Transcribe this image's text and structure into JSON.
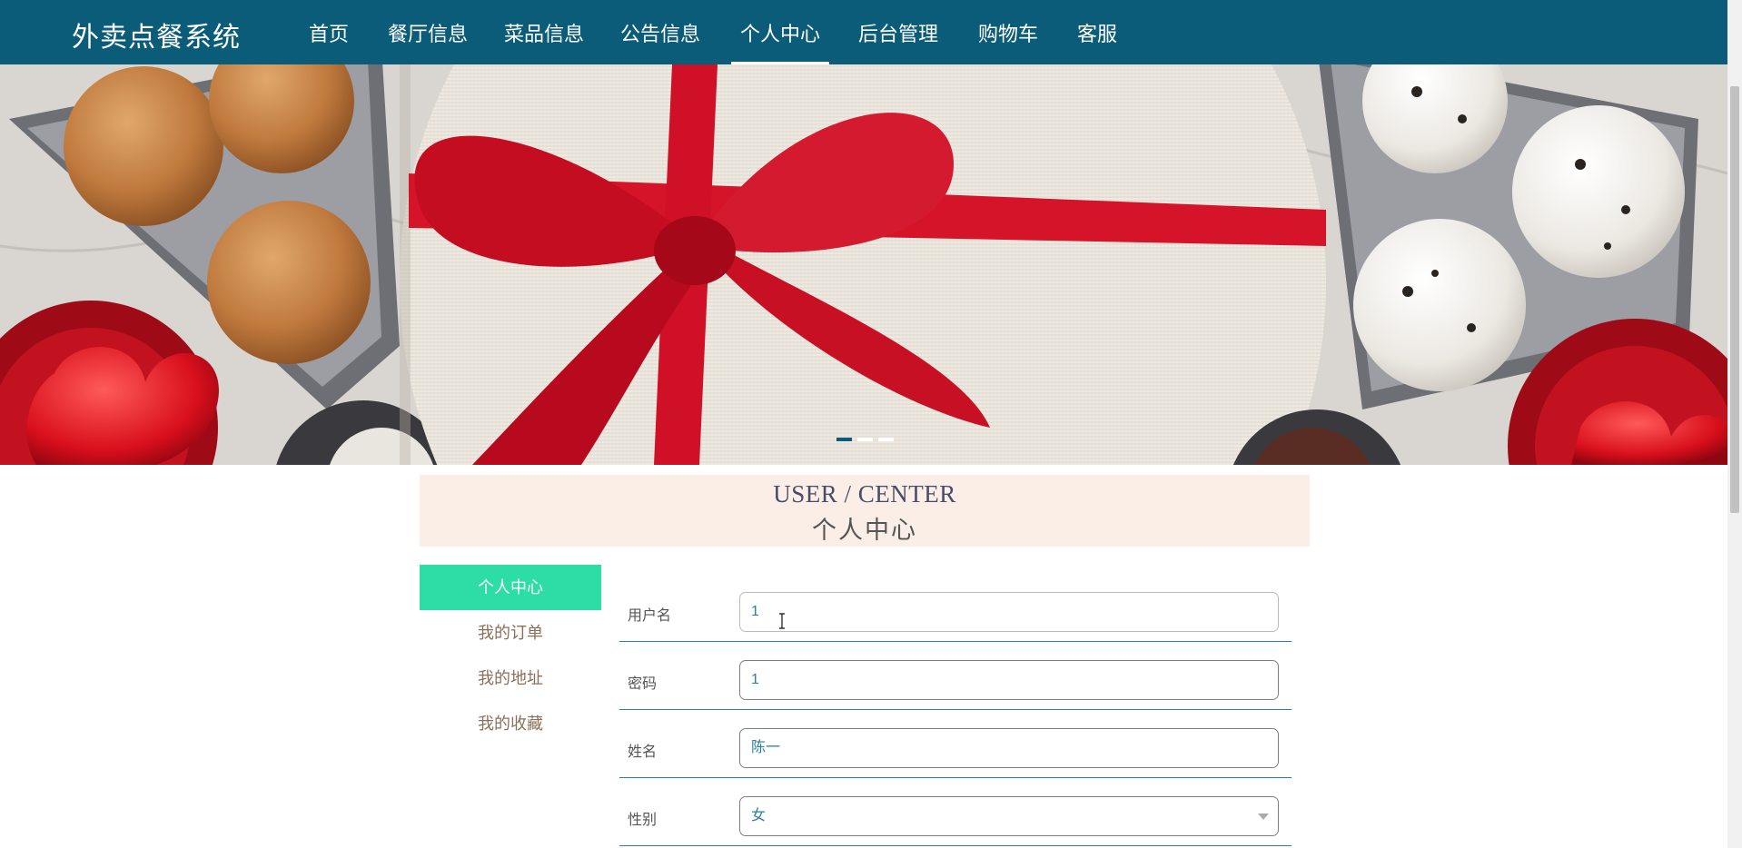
{
  "nav": {
    "brand": "外卖点餐系统",
    "items": [
      "首页",
      "餐厅信息",
      "菜品信息",
      "公告信息",
      "个人中心",
      "后台管理",
      "购物车",
      "客服"
    ],
    "active": "个人中心"
  },
  "banner": {
    "slides": 3,
    "active_slide": 1
  },
  "section": {
    "title_en": "USER / CENTER",
    "title_zh": "个人中心"
  },
  "sidebar": {
    "items": [
      {
        "label": "个人中心",
        "active": true
      },
      {
        "label": "我的订单",
        "active": false
      },
      {
        "label": "我的地址",
        "active": false
      },
      {
        "label": "我的收藏",
        "active": false
      }
    ]
  },
  "form": {
    "username": {
      "label": "用户名",
      "value": "1"
    },
    "password": {
      "label": "密码",
      "value": "1"
    },
    "name": {
      "label": "姓名",
      "value": "陈一"
    },
    "gender": {
      "label": "性别",
      "value": "女"
    }
  },
  "colors": {
    "nav_bg": "#0b5c78",
    "accent_green": "#2edca6",
    "section_bg": "#fbeee7",
    "link_brown": "#8b6f5a"
  }
}
